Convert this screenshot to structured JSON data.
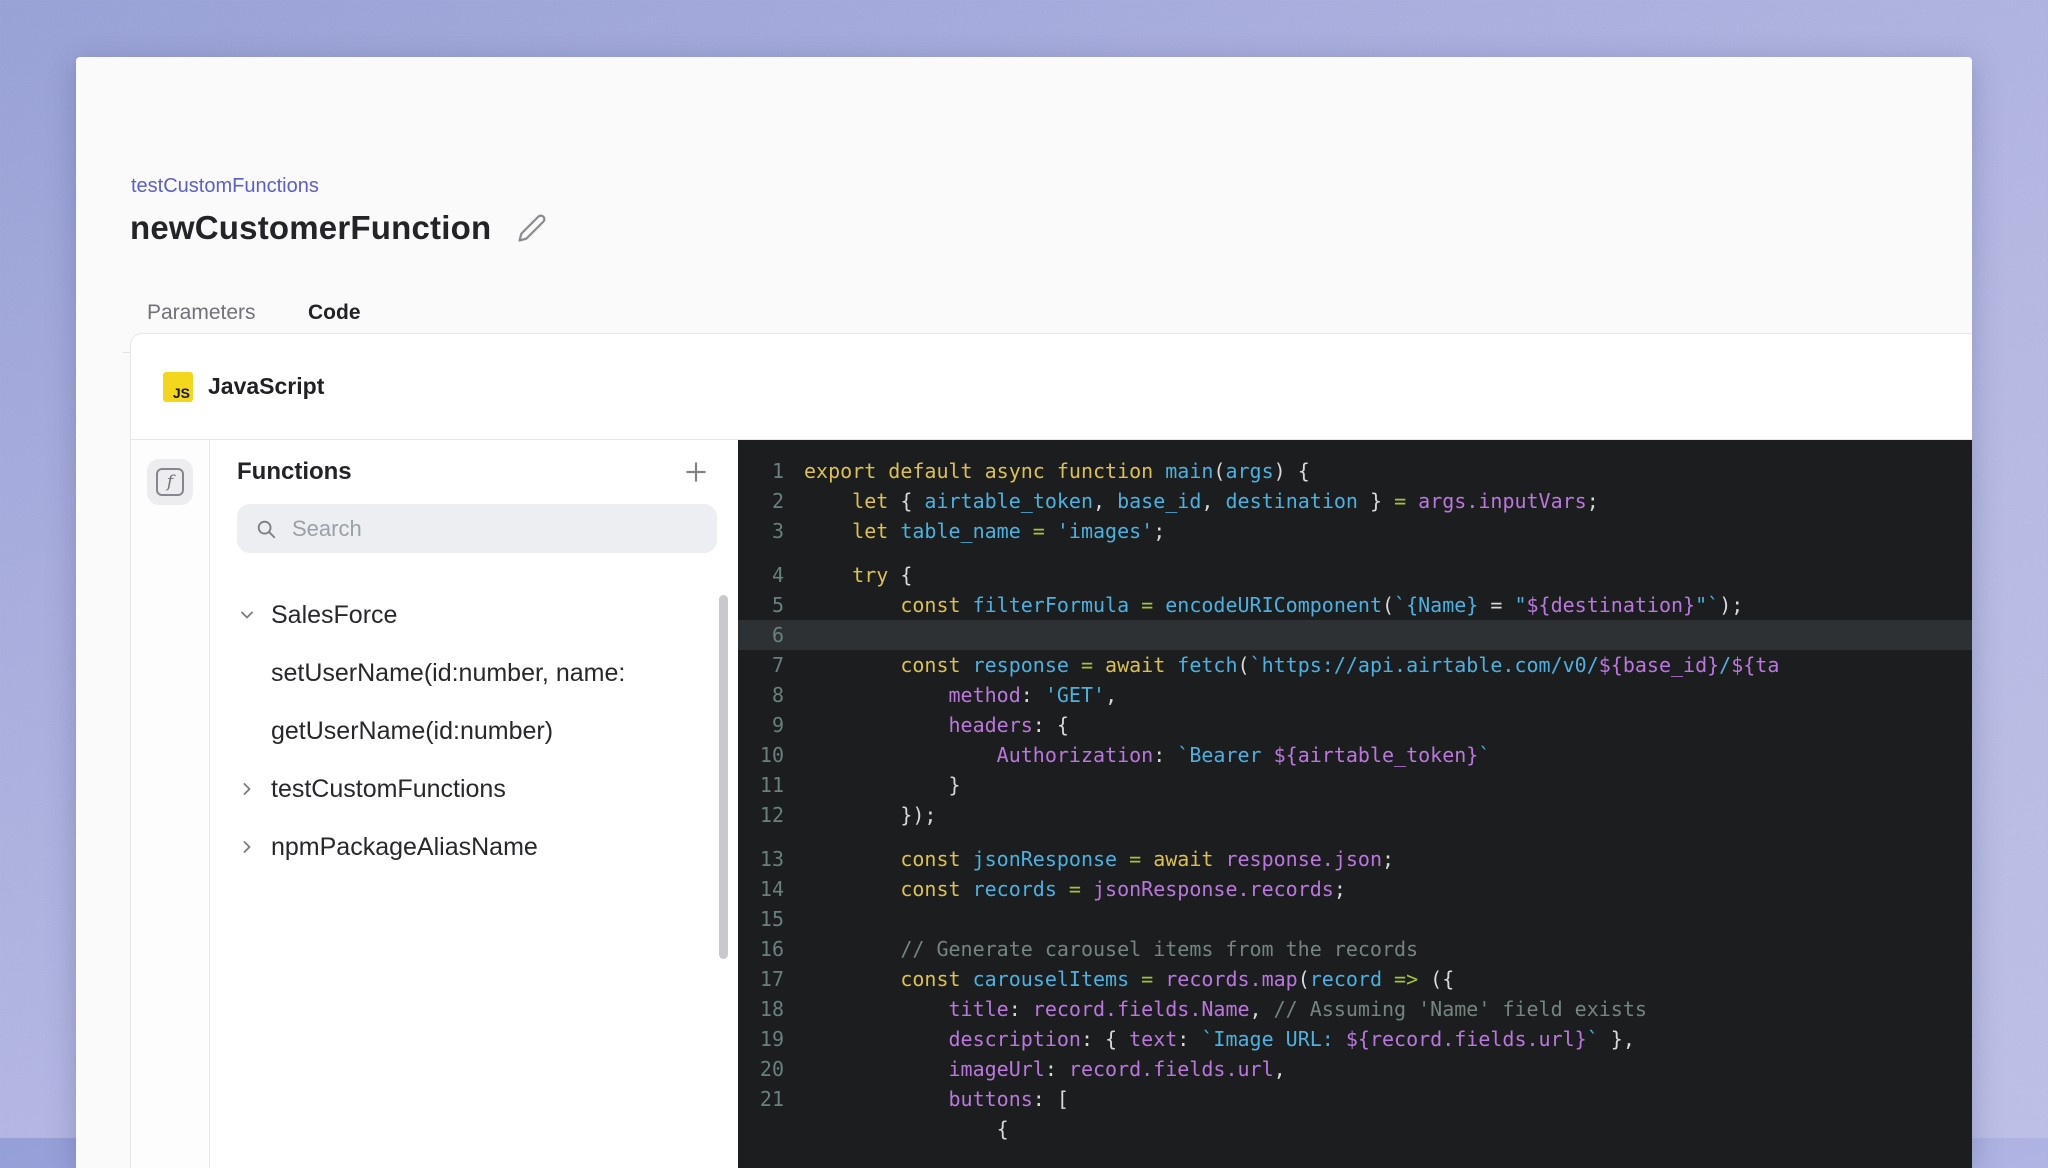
{
  "page": {
    "breadcrumb": "testCustomFunctions",
    "title": "newCustomerFunction"
  },
  "tabs": [
    {
      "label": "Parameters",
      "active": false
    },
    {
      "label": "Code",
      "active": true
    }
  ],
  "editor_card": {
    "language": "JavaScript",
    "badge": "JS"
  },
  "sidebar": {
    "heading": "Functions",
    "search_placeholder": "Search",
    "rail_icon_glyph": "f",
    "tree": [
      {
        "label": "SalesForce",
        "chevron": "down"
      },
      {
        "label": "setUserName(id:number, name:",
        "chevron": "none"
      },
      {
        "label": "getUserName(id:number)",
        "chevron": "none"
      },
      {
        "label": "testCustomFunctions",
        "chevron": "right"
      },
      {
        "label": "npmPackageAliasName",
        "chevron": "right"
      }
    ]
  },
  "icons": {
    "edit": "pencil-icon",
    "add": "plus-icon",
    "search": "magnifier-icon",
    "rail": "function-icon",
    "expanded": "chevron-down-icon",
    "collapsed": "chevron-right-icon"
  },
  "colors": {
    "accent": "#5a5ecf",
    "tab_underline": "#5753d4",
    "badge_yellow": "#f2d71d",
    "background_lavender": "#aab0e0",
    "editor_background": "#1b1d1e",
    "line_highlight": "#2e3133",
    "syntax": {
      "keyword": "#dcc051",
      "identifier_string": "#4cb1e0",
      "property_interpolation": "#bb77dd",
      "operator": "#a6c13f",
      "punctuation": "#d7d9da",
      "comment": "#75847f",
      "line_number": "#69807f"
    }
  },
  "code": {
    "lines": [
      {
        "n": "1",
        "t": [
          [
            "y",
            "export default async function "
          ],
          [
            "c",
            "main"
          ],
          [
            "w",
            "("
          ],
          [
            "c",
            "args"
          ],
          [
            "w",
            ") {"
          ]
        ]
      },
      {
        "n": "2",
        "t": [
          [
            "y",
            "    let "
          ],
          [
            "w",
            "{ "
          ],
          [
            "c",
            "airtable_token"
          ],
          [
            "w",
            ", "
          ],
          [
            "c",
            "base_id"
          ],
          [
            "w",
            ", "
          ],
          [
            "c",
            "destination"
          ],
          [
            "w",
            " } "
          ],
          [
            "g",
            "="
          ],
          [
            "p",
            " args.inputVars"
          ],
          [
            "w",
            ";"
          ]
        ]
      },
      {
        "n": "3",
        "t": [
          [
            "y",
            "    let "
          ],
          [
            "c",
            "table_name"
          ],
          [
            "g",
            " ="
          ],
          [
            "c",
            " 'images'"
          ],
          [
            "w",
            ";"
          ]
        ]
      },
      {
        "n": "4",
        "gap": true,
        "t": [
          [
            "y",
            "    try "
          ],
          [
            "w",
            "{"
          ]
        ]
      },
      {
        "n": "5",
        "t": [
          [
            "y",
            "        const "
          ],
          [
            "c",
            "filterFormula"
          ],
          [
            "g",
            " = "
          ],
          [
            "c",
            "encodeURIComponent"
          ],
          [
            "w",
            "("
          ],
          [
            "c",
            "`{Name} "
          ],
          [
            "w",
            "= "
          ],
          [
            "c",
            "\""
          ],
          [
            "p",
            "${destination}"
          ],
          [
            "c",
            "\"`"
          ],
          [
            "w",
            ");"
          ]
        ]
      },
      {
        "n": "6",
        "hl": true,
        "t": []
      },
      {
        "n": "7",
        "t": [
          [
            "y",
            "        const "
          ],
          [
            "c",
            "response"
          ],
          [
            "g",
            " = "
          ],
          [
            "y",
            "await "
          ],
          [
            "c",
            "fetch"
          ],
          [
            "w",
            "("
          ],
          [
            "c",
            "`https://api.airtable.com/v0/"
          ],
          [
            "p",
            "${base_id}"
          ],
          [
            "c",
            "/"
          ],
          [
            "p",
            "${ta"
          ]
        ]
      },
      {
        "n": "8",
        "t": [
          [
            "p",
            "            method"
          ],
          [
            "w",
            ": "
          ],
          [
            "c",
            "'GET'"
          ],
          [
            "w",
            ","
          ]
        ]
      },
      {
        "n": "9",
        "t": [
          [
            "p",
            "            headers"
          ],
          [
            "w",
            ": {"
          ]
        ]
      },
      {
        "n": "10",
        "t": [
          [
            "p",
            "                Authorization"
          ],
          [
            "w",
            ": "
          ],
          [
            "c",
            "`Bearer "
          ],
          [
            "p",
            "${airtable_token}"
          ],
          [
            "c",
            "`"
          ]
        ]
      },
      {
        "n": "11",
        "t": [
          [
            "w",
            "            }"
          ]
        ]
      },
      {
        "n": "12",
        "t": [
          [
            "w",
            "        });"
          ]
        ]
      },
      {
        "n": "13",
        "gap": true,
        "t": [
          [
            "y",
            "        const "
          ],
          [
            "c",
            "jsonResponse"
          ],
          [
            "g",
            " = "
          ],
          [
            "y",
            "await "
          ],
          [
            "p",
            "response.json"
          ],
          [
            "w",
            ";"
          ]
        ]
      },
      {
        "n": "14",
        "t": [
          [
            "y",
            "        const "
          ],
          [
            "c",
            "records"
          ],
          [
            "g",
            " = "
          ],
          [
            "p",
            "jsonResponse.records"
          ],
          [
            "w",
            ";"
          ]
        ]
      },
      {
        "n": "15",
        "t": []
      },
      {
        "n": "16",
        "t": [
          [
            "m",
            "        // Generate carousel items from the records"
          ]
        ]
      },
      {
        "n": "17",
        "t": [
          [
            "y",
            "        const "
          ],
          [
            "c",
            "carouselItems"
          ],
          [
            "g",
            " = "
          ],
          [
            "p",
            "records.map"
          ],
          [
            "w",
            "("
          ],
          [
            "c",
            "record"
          ],
          [
            "g",
            " => "
          ],
          [
            "w",
            "({"
          ]
        ]
      },
      {
        "n": "18",
        "t": [
          [
            "p",
            "            title"
          ],
          [
            "w",
            ": "
          ],
          [
            "p",
            "record.fields.Name"
          ],
          [
            "w",
            ", "
          ],
          [
            "m",
            "// Assuming 'Name' field exists"
          ]
        ]
      },
      {
        "n": "19",
        "t": [
          [
            "p",
            "            description"
          ],
          [
            "w",
            ": { "
          ],
          [
            "p",
            "text"
          ],
          [
            "w",
            ": "
          ],
          [
            "c",
            "`Image URL: "
          ],
          [
            "p",
            "${record.fields.url}"
          ],
          [
            "c",
            "`"
          ],
          [
            "w",
            " },"
          ]
        ]
      },
      {
        "n": "20",
        "t": [
          [
            "p",
            "            imageUrl"
          ],
          [
            "w",
            ": "
          ],
          [
            "p",
            "record.fields.url"
          ],
          [
            "w",
            ","
          ]
        ]
      },
      {
        "n": "21",
        "t": [
          [
            "p",
            "            buttons"
          ],
          [
            "w",
            ": ["
          ]
        ]
      },
      {
        "n": "",
        "t": [
          [
            "w",
            "                {"
          ]
        ]
      }
    ]
  }
}
